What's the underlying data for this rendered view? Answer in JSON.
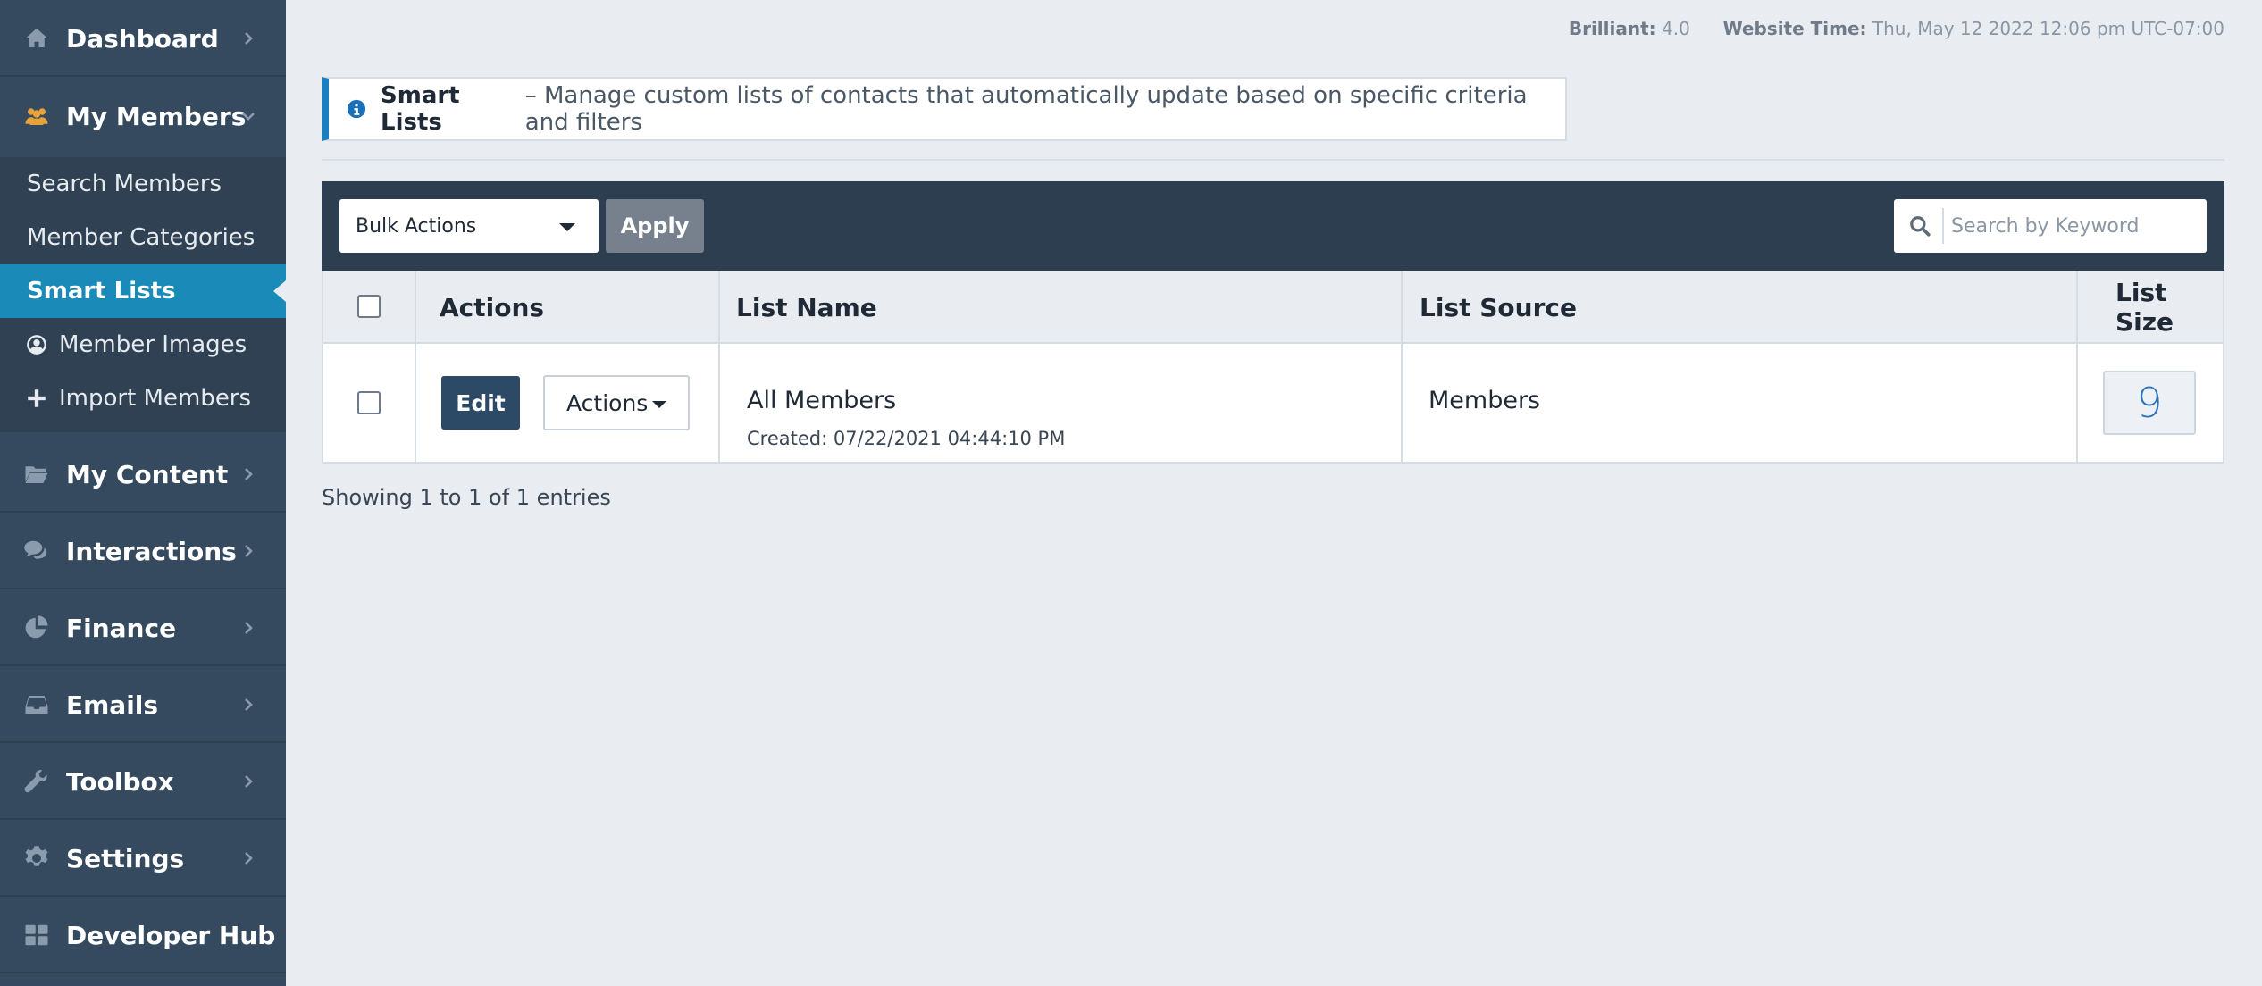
{
  "sidebar": {
    "items": [
      {
        "label": "Dashboard",
        "icon": "home-icon"
      },
      {
        "label": "My Members",
        "icon": "users-icon"
      },
      {
        "label": "My Content",
        "icon": "folder-icon"
      },
      {
        "label": "Interactions",
        "icon": "comments-icon"
      },
      {
        "label": "Finance",
        "icon": "pie-chart-icon"
      },
      {
        "label": "Emails",
        "icon": "inbox-icon"
      },
      {
        "label": "Toolbox",
        "icon": "wrench-icon"
      },
      {
        "label": "Settings",
        "icon": "gear-icon"
      },
      {
        "label": "Developer Hub",
        "icon": "grid-icon"
      }
    ],
    "submenu": [
      {
        "label": "Search Members"
      },
      {
        "label": "Member Categories"
      },
      {
        "label": "Smart Lists",
        "active": true
      },
      {
        "label": "Member Images",
        "icon": "user-circle-icon"
      },
      {
        "label": "Import Members",
        "icon": "plus-icon"
      }
    ]
  },
  "header": {
    "version_label": "Brilliant:",
    "version_value": "4.0",
    "time_label": "Website Time:",
    "time_value": "Thu, May 12 2022 12:06 pm UTC-07:00"
  },
  "banner": {
    "title": "Smart Lists",
    "description": "– Manage custom lists of contacts that automatically update based on specific criteria and filters"
  },
  "toolbar": {
    "bulk_actions": "Bulk Actions",
    "apply": "Apply",
    "search_placeholder": "Search by Keyword"
  },
  "table": {
    "columns": [
      "Actions",
      "List Name",
      "List Source",
      "List Size"
    ],
    "rows": [
      {
        "edit": "Edit",
        "actions": "Actions",
        "name": "All Members",
        "created": "Created: 07/22/2021 04:44:10 PM",
        "source": "Members",
        "size": "9"
      }
    ]
  },
  "footer": {
    "entries": "Showing 1 to 1 of 1 entries"
  },
  "colors": {
    "sidebar": "#354a5e",
    "active": "#1a8bb8",
    "toolbar": "#2c3e50",
    "accent": "#1a7fc1"
  }
}
